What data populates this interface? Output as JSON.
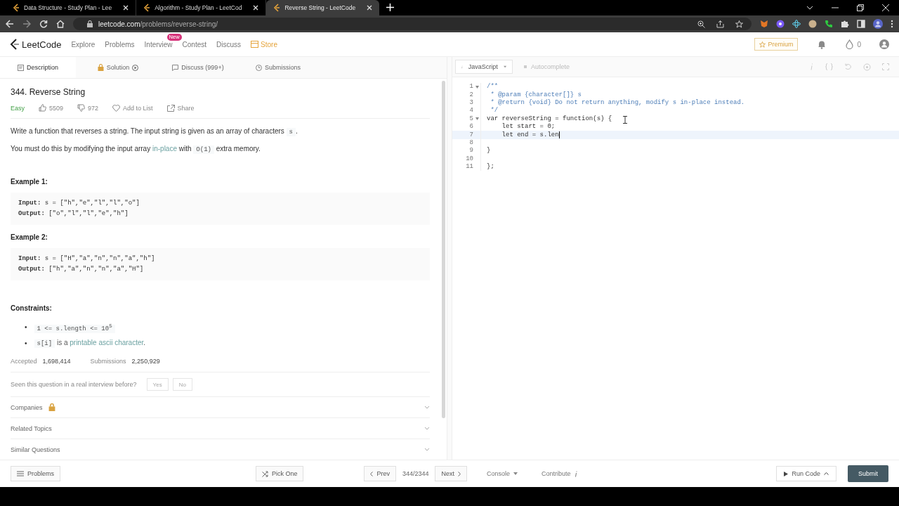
{
  "browser": {
    "tabs": [
      {
        "title": "Data Structure - Study Plan - Lee",
        "selected": false
      },
      {
        "title": "Algorithm - Study Plan - LeetCod",
        "selected": false
      },
      {
        "title": "Reverse String - LeetCode",
        "selected": true
      }
    ],
    "url": {
      "host": "leetcode.com",
      "path": "/problems/reverse-string/"
    }
  },
  "nav": {
    "logo": "LeetCode",
    "links": [
      {
        "label": "Explore",
        "kind": "plain"
      },
      {
        "label": "Problems",
        "kind": "plain"
      },
      {
        "label": "Interview",
        "kind": "plain",
        "badge": "New"
      },
      {
        "label": "Contest",
        "kind": "plain"
      },
      {
        "label": "Discuss",
        "kind": "plain"
      },
      {
        "label": "Store",
        "kind": "store"
      }
    ],
    "premium": "Premium",
    "streak": "0"
  },
  "left_tabs": [
    {
      "label": "Description",
      "selected": true
    },
    {
      "label": "Solution",
      "selected": false
    },
    {
      "label": "Discuss (999+)",
      "selected": false
    },
    {
      "label": "Submissions",
      "selected": false
    }
  ],
  "problem": {
    "title": "344. Reverse String",
    "difficulty": "Easy",
    "likes": "5509",
    "dislikes": "972",
    "add_to_list": "Add to List",
    "share": "Share",
    "paragraphs": [
      [
        {
          "kind": "text",
          "text": "Write a function that reverses a string. The input string is given as an array of characters "
        },
        {
          "kind": "code",
          "text": "s"
        },
        {
          "kind": "text",
          "text": "."
        }
      ],
      [
        {
          "kind": "text",
          "text": "You must do this by modifying the input array "
        },
        {
          "kind": "link",
          "text": "in-place"
        },
        {
          "kind": "text",
          "text": " with "
        },
        {
          "kind": "code",
          "text": "O(1)"
        },
        {
          "kind": "text",
          "text": " extra memory."
        }
      ]
    ],
    "examples": [
      {
        "title": "Example 1:",
        "lines": [
          "**Input:** s = [\"h\",\"e\",\"l\",\"l\",\"o\"]",
          "**Output:** [\"o\",\"l\",\"l\",\"e\",\"h\"]"
        ]
      },
      {
        "title": "Example 2:",
        "lines": [
          "**Input:** s = [\"H\",\"a\",\"n\",\"n\",\"a\",\"h\"]",
          "**Output:** [\"h\",\"a\",\"n\",\"n\",\"a\",\"H\"]"
        ]
      }
    ],
    "constraints_title": "Constraints:",
    "constraints": [
      {
        "bullet": "•",
        "parts": [
          {
            "kind": "code",
            "text": "1 <= s.length <= 10$^{5}$"
          }
        ]
      },
      {
        "bullet": "•",
        "parts": [
          {
            "kind": "code",
            "text": "s[i]"
          },
          {
            "kind": "text",
            "text": " is a "
          },
          {
            "kind": "link",
            "text": "printable ascii character"
          },
          {
            "kind": "text",
            "text": "."
          }
        ]
      }
    ],
    "accepted_label": "Accepted",
    "accepted": "1,698,414",
    "submissions_label": "Submissions",
    "submissions": "2,250,929",
    "interview_question": "Seen this question in a real interview before?",
    "answers": [
      "Yes",
      "No"
    ],
    "sections": [
      {
        "label": "Companies",
        "locked": true
      },
      {
        "label": "Related Topics",
        "locked": false
      },
      {
        "label": "Similar Questions",
        "locked": false
      }
    ]
  },
  "editor": {
    "language": "JavaScript",
    "autocomplete": "Autocomplete",
    "lines": [
      {
        "number": "1",
        "fold": true,
        "kind": "comment",
        "text": "/**",
        "current": false
      },
      {
        "number": "2",
        "fold": false,
        "kind": "comment",
        "text": " * @param {character[]} s",
        "current": false
      },
      {
        "number": "3",
        "fold": false,
        "kind": "comment",
        "text": " * @return {void} Do not return anything, modify s in-place instead.",
        "current": false
      },
      {
        "number": "4",
        "fold": false,
        "kind": "comment",
        "text": " */",
        "current": false
      },
      {
        "number": "5",
        "fold": true,
        "kind": "code",
        "text": "var reverseString = function(s) {",
        "current": false
      },
      {
        "number": "6",
        "fold": false,
        "kind": "code",
        "text": "    let start = 0;",
        "current": false
      },
      {
        "number": "7",
        "fold": false,
        "kind": "code",
        "text": "    let end = s.len",
        "current": true
      },
      {
        "number": "8",
        "fold": false,
        "current": false
      },
      {
        "number": "9",
        "fold": false,
        "kind": "code",
        "text": "}",
        "current": false
      },
      {
        "number": "10",
        "fold": false,
        "current": false
      },
      {
        "number": "11",
        "fold": false,
        "kind": "code",
        "text": "};",
        "current": false
      }
    ]
  },
  "footer": {
    "problems": "Problems",
    "pick_one": "Pick One",
    "prev": "Prev",
    "position": "344/2344",
    "next": "Next",
    "console": "Console",
    "contribute": "Contribute",
    "run_code": "Run Code",
    "submit": "Submit"
  }
}
